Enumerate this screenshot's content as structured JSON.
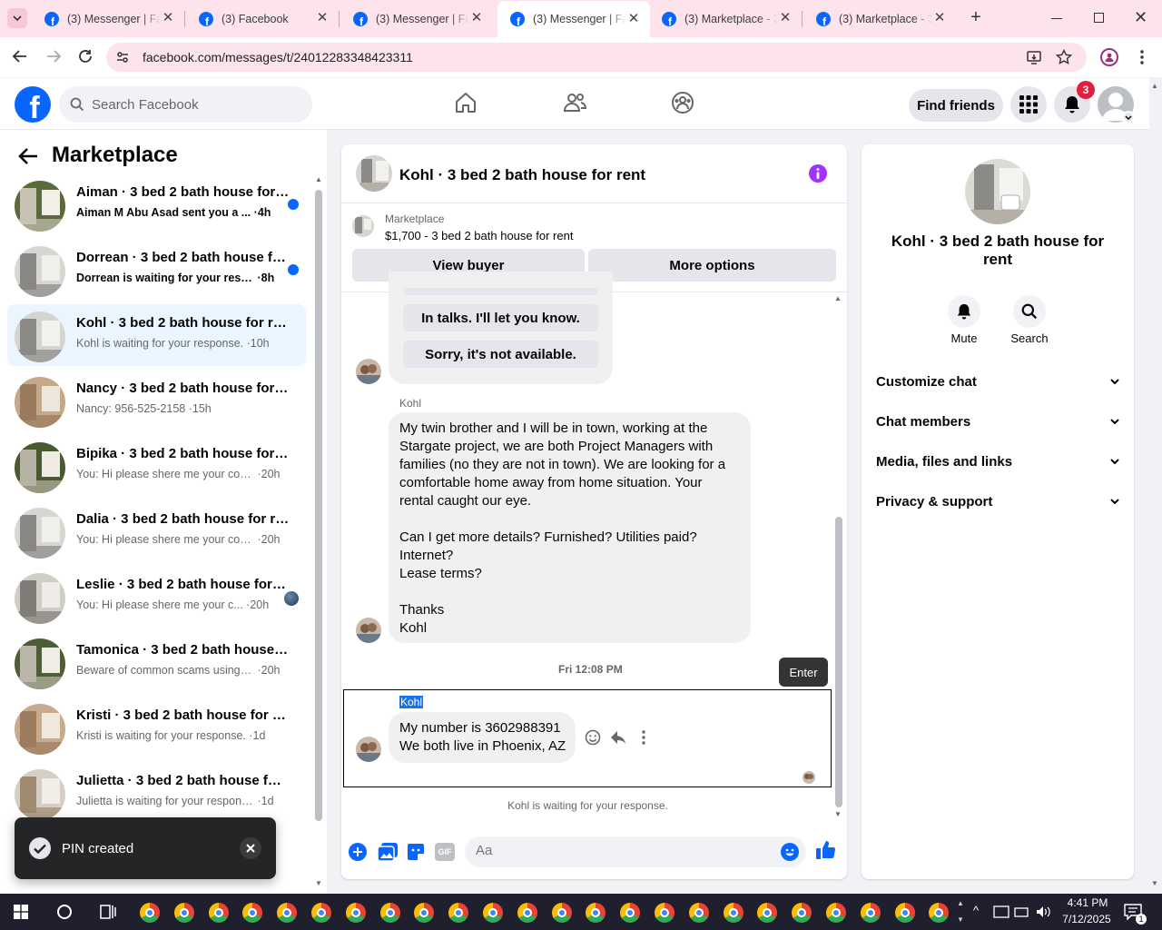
{
  "browser": {
    "tabs": [
      {
        "title": "(3) Messenger | Fac",
        "active": false
      },
      {
        "title": "(3) Facebook",
        "active": false
      },
      {
        "title": "(3) Messenger | Fac",
        "active": false
      },
      {
        "title": "(3) Messenger | Fac",
        "active": true
      },
      {
        "title": "(3) Marketplace - 3",
        "active": false
      },
      {
        "title": "(3) Marketplace - 3",
        "active": false
      }
    ],
    "url": "facebook.com/messages/t/24012283348423311"
  },
  "header": {
    "search_placeholder": "Search Facebook",
    "find_friends": "Find friends",
    "notification_count": "3"
  },
  "sidebar": {
    "title": "Marketplace",
    "conversations": [
      {
        "name": "Aiman · 3 bed 2 bath house for rent",
        "preview": "Aiman M Abu Asad sent you a ...",
        "time": "4h",
        "unread": true
      },
      {
        "name": "Dorrean · 3 bed 2 bath house for rent",
        "preview": "Dorrean is waiting for your resp...",
        "time": "8h",
        "unread": true
      },
      {
        "name": "Kohl · 3 bed 2 bath house for rent",
        "preview": "Kohl is waiting for your response.",
        "time": "10h",
        "unread": false,
        "selected": true
      },
      {
        "name": "Nancy · 3 bed 2 bath house for rent",
        "preview": "Nancy: 956-525-2158",
        "time": "15h",
        "unread": false
      },
      {
        "name": "Bipika · 3 bed 2 bath house for rent",
        "preview": "You: Hi please shere me your cont...",
        "time": "20h",
        "unread": false
      },
      {
        "name": "Dalia · 3 bed 2 bath house for rent",
        "preview": "You: Hi please shere me your cont...",
        "time": "20h",
        "unread": false
      },
      {
        "name": "Leslie · 3 bed 2 bath house for rent",
        "preview": "You: Hi please shere me your c...",
        "time": "20h",
        "unread": false,
        "seen": true
      },
      {
        "name": "Tamonica · 3 bed 2 bath house for rent",
        "preview": "Beware of common scams using p...",
        "time": "20h",
        "unread": false
      },
      {
        "name": "Kristi · 3 bed 2 bath house for rent",
        "preview": "Kristi is waiting for your response.",
        "time": "1d",
        "unread": false
      },
      {
        "name": "Julietta · 3 bed 2 bath house for rent",
        "preview": "Julietta is waiting for your response.",
        "time": "1d",
        "unread": false
      }
    ]
  },
  "toast": {
    "text": "PIN created"
  },
  "chat": {
    "title": "Kohl · 3 bed 2 bath house for rent",
    "listing_label": "Marketplace",
    "listing_price": "$1,700 - 3 bed 2 bath house for rent",
    "view_buyer": "View buyer",
    "more_options": "More options",
    "quick_replies": [
      "In talks. I'll let you know.",
      "Sorry, it's not available."
    ],
    "sender": "Kohl",
    "message1_lines": [
      "My twin brother and I will be in town, working at the",
      "Stargate project, we are both Project Managers with",
      "families (no they are not in town). We are looking for a",
      "comfortable home away from home situation. Your",
      "rental caught our eye.",
      "",
      "Can I get more details? Furnished? Utilities paid?",
      "Internet?",
      "Lease terms?",
      "",
      "Thanks",
      "Kohl"
    ],
    "timestamp": "Fri 12:08 PM",
    "tooltip": "Enter",
    "sender2": "Kohl",
    "message2_lines": [
      "My number is 3602988391",
      "We both live in Phoenix, AZ"
    ],
    "waiting_text": "Kohl is waiting for your response.",
    "composer_placeholder": "Aa"
  },
  "info": {
    "title": "Kohl · 3 bed 2 bath house for rent",
    "mute": "Mute",
    "search": "Search",
    "sections": [
      "Customize chat",
      "Chat members",
      "Media, files and links",
      "Privacy & support"
    ]
  },
  "taskbar": {
    "time": "4:41 PM",
    "date": "7/12/2025",
    "notif_count": "1"
  },
  "colors": {
    "fb_blue": "#0866ff",
    "purple": "#a033ff",
    "selected_bg": "#ebf5ff"
  }
}
